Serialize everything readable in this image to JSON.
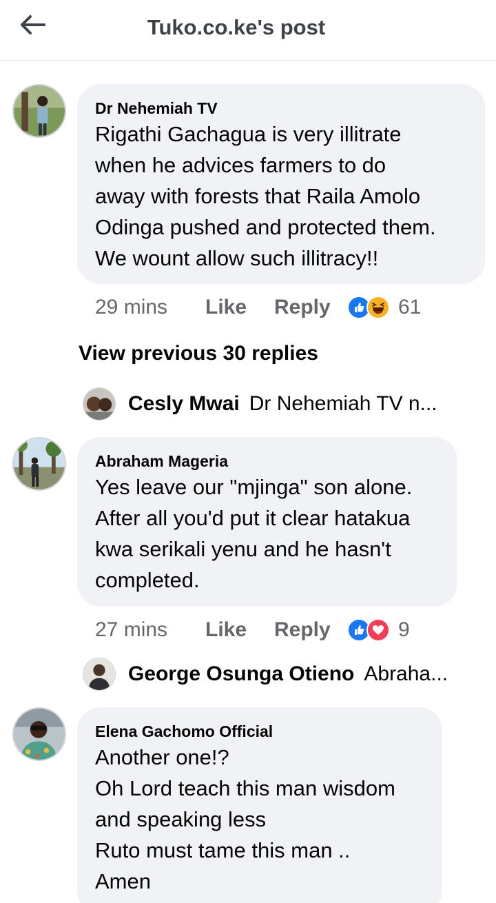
{
  "header": {
    "title": "Tuko.co.ke's post",
    "back_icon": "arrow-left-icon"
  },
  "comments": [
    {
      "author": "Dr Nehemiah TV",
      "text": "Rigathi Gachagua is very illitrate\nwhen he advices farmers to do\naway with forests that Raila Amolo\nOdinga pushed and protected them.\nWe wount allow such illitracy!!",
      "time": "29 mins",
      "like_label": "Like",
      "reply_label": "Reply",
      "reactions": [
        "like-reaction-icon",
        "haha-reaction-icon"
      ],
      "reaction_count": "61"
    },
    {
      "author": "Abraham Mageria",
      "text": "Yes leave our \"mjinga\" son alone.\nAfter all you'd put it clear hatakua\nkwa serikali yenu and he hasn't\ncompleted.",
      "time": "27 mins",
      "like_label": "Like",
      "reply_label": "Reply",
      "reactions": [
        "like-reaction-icon",
        "love-reaction-icon"
      ],
      "reaction_count": "9"
    },
    {
      "author": "Elena Gachomo Official",
      "text": "Another one!?\nOh Lord teach this man wisdom\nand speaking less\nRuto must tame this man ..\nAmen"
    }
  ],
  "view_previous_label": "View previous 30 replies",
  "replies": [
    {
      "author": "Cesly Mwai",
      "snippet": "Dr Nehemiah TV n..."
    },
    {
      "author": "George Osunga Otieno",
      "snippet": "Abraha..."
    }
  ],
  "colors": {
    "bubble_bg": "#f0f2f5",
    "secondary_text": "#65676b",
    "like_blue": "#1877f2",
    "love_red": "#f33e58",
    "haha_yellow": "#f7b125"
  }
}
